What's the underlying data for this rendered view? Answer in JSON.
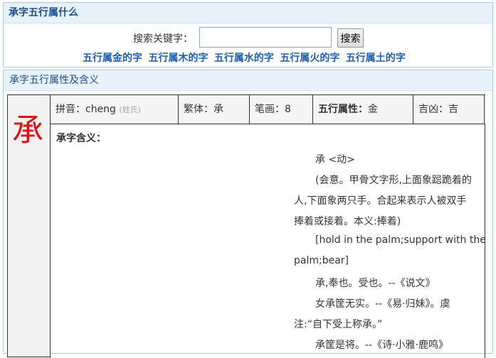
{
  "header": {
    "title": "承字五行属什么"
  },
  "search": {
    "label": "搜索关键字：",
    "value": "",
    "button_label": "搜索"
  },
  "links": [
    "五行属金的字",
    "五行属木的字",
    "五行属水的字",
    "五行属火的字",
    "五行属土的字"
  ],
  "section": {
    "title": "承字五行属性及含义"
  },
  "character": "承",
  "info": {
    "pinyin_label": "拼音：",
    "pinyin_value": "cheng",
    "pinyin_note": "(姓氏)",
    "traditional_label": "繁体：",
    "traditional_value": "承",
    "strokes_label": "笔画：",
    "strokes_value": "8",
    "wuxing_label": "五行属性：",
    "wuxing_value": "金",
    "jixiong_label": "吉凶：",
    "jixiong_value": "吉"
  },
  "meaning": {
    "title": "承字含义：",
    "lines": [
      "承 <动>",
      "(会意。甲骨文字形,上面象跽跪着的",
      "人,下面象两只手。合起来表示人被双手",
      "捧着或接着。本义:捧着)",
      "[hold in the palm;support with the",
      "palm;bear]",
      "承,奉也。受也。--《说文》",
      "女承筐无实。--《易·归妹》。虞",
      "注:“自下受上称承。”",
      "承筐是将。--《诗·小雅·鹿鸣》"
    ]
  }
}
